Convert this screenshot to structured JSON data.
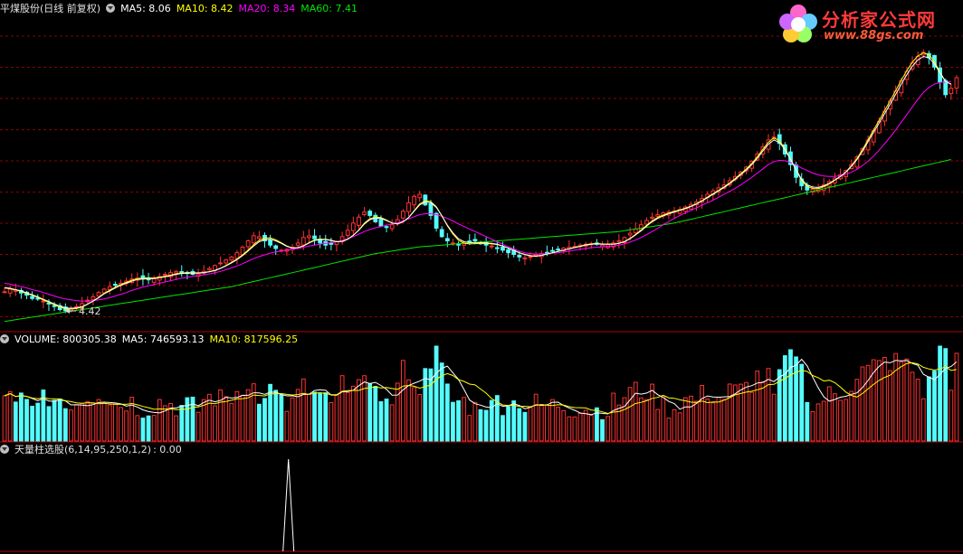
{
  "main_header": {
    "stock_name": "平煤股份(日线 前复权)",
    "ma5": "MA5: 8.06",
    "ma10": "MA10: 8.42",
    "ma20": "MA20: 8.34",
    "ma60": "MA60: 7.41"
  },
  "volume_header": {
    "volume": "VOLUME: 800305.38",
    "ma5": "MA5: 746593.13",
    "ma10": "MA10: 817596.25"
  },
  "indicator_header": {
    "label": "天量柱选股(6,14,95,250,1,2)",
    "value": ": 0.00"
  },
  "logo": {
    "title": "分析家公式网",
    "url": "www.88gs.com"
  },
  "low_marker": "4.42",
  "colors": {
    "up": "#ff3232",
    "down": "#54fcfc",
    "ma5": "#ffffff",
    "ma10": "#ffff00",
    "ma20": "#ff00ff",
    "ma60": "#00e600",
    "grid": "#8b0000",
    "divider": "#b00000"
  },
  "chart_data": {
    "type": "candlestick",
    "price_range": [
      4.0,
      11.4
    ],
    "indicator_signals_at_bar": [
      51,
      220
    ],
    "closes": [
      4.9,
      4.96,
      4.94,
      4.87,
      4.82,
      4.74,
      4.73,
      4.68,
      4.61,
      4.55,
      4.48,
      4.45,
      4.5,
      4.55,
      4.62,
      4.7,
      4.78,
      4.88,
      4.96,
      5.02,
      5.06,
      5.1,
      5.15,
      5.2,
      5.22,
      5.2,
      5.18,
      5.21,
      5.26,
      5.31,
      5.35,
      5.38,
      5.36,
      5.33,
      5.31,
      5.32,
      5.38,
      5.45,
      5.52,
      5.58,
      5.65,
      5.72,
      5.82,
      5.95,
      6.1,
      6.22,
      6.2,
      6.1,
      6.0,
      5.92,
      5.88,
      5.9,
      5.95,
      6.05,
      6.18,
      6.22,
      6.15,
      6.05,
      6.0,
      6.02,
      6.08,
      6.2,
      6.35,
      6.52,
      6.66,
      6.78,
      6.7,
      6.55,
      6.45,
      6.42,
      6.48,
      6.6,
      6.8,
      7.0,
      7.15,
      7.2,
      6.95,
      6.7,
      6.4,
      6.2,
      6.1,
      6.05,
      6.0,
      6.05,
      6.08,
      6.1,
      6.05,
      6.0,
      5.98,
      5.92,
      5.88,
      5.82,
      5.78,
      5.72,
      5.7,
      5.73,
      5.77,
      5.8,
      5.83,
      5.86,
      5.9,
      5.93,
      5.95,
      5.97,
      6.0,
      6.02,
      6.03,
      6.02,
      6.0,
      6.01,
      6.05,
      6.1,
      6.18,
      6.28,
      6.38,
      6.48,
      6.58,
      6.66,
      6.72,
      6.76,
      6.78,
      6.8,
      6.84,
      6.9,
      6.96,
      7.02,
      7.1,
      7.2,
      7.28,
      7.35,
      7.42,
      7.52,
      7.62,
      7.72,
      7.84,
      7.98,
      8.15,
      8.32,
      8.48,
      8.55,
      8.4,
      8.15,
      7.9,
      7.6,
      7.4,
      7.3,
      7.32,
      7.35,
      7.42,
      7.5,
      7.58,
      7.66,
      7.76,
      7.9,
      8.08,
      8.28,
      8.48,
      8.7,
      8.92,
      9.16,
      9.4,
      9.64,
      9.88,
      10.1,
      10.3,
      10.45,
      10.55,
      10.42,
      10.2,
      9.85,
      9.55,
      9.7,
      9.95
    ],
    "ma5": [
      5.0,
      4.98,
      4.95,
      4.92,
      4.87,
      4.83,
      4.78,
      4.72,
      4.67,
      4.61,
      4.56,
      4.52,
      4.51,
      4.52,
      4.55,
      4.61,
      4.68,
      4.76,
      4.85,
      4.92,
      4.99,
      5.05,
      5.1,
      5.15,
      5.19,
      5.2,
      5.21,
      5.21,
      5.23,
      5.25,
      5.28,
      5.31,
      5.33,
      5.34,
      5.34,
      5.34,
      5.35,
      5.37,
      5.4,
      5.45,
      5.51,
      5.58,
      5.66,
      5.75,
      5.86,
      5.98,
      6.08,
      6.13,
      6.14,
      6.1,
      6.04,
      5.97,
      5.93,
      5.94,
      5.98,
      6.05,
      6.11,
      6.13,
      6.13,
      6.11,
      6.08,
      6.09,
      6.14,
      6.23,
      6.35,
      6.5,
      6.6,
      6.64,
      6.63,
      6.58,
      6.52,
      6.5,
      6.55,
      6.65,
      6.8,
      6.95,
      7.02,
      7.0,
      6.89,
      6.69,
      6.47,
      6.29,
      6.15,
      6.08,
      6.06,
      6.06,
      6.06,
      6.05,
      6.04,
      6.02,
      5.98,
      5.93,
      5.88,
      5.82,
      5.78,
      5.75,
      5.74,
      5.76,
      5.79,
      5.82,
      5.85,
      5.88,
      5.91,
      5.94,
      5.97,
      6.0,
      6.02,
      6.03,
      6.02,
      6.02,
      6.02,
      6.04,
      6.08,
      6.15,
      6.24,
      6.34,
      6.45,
      6.55,
      6.63,
      6.69,
      6.74,
      6.78,
      6.82,
      6.86,
      6.91,
      6.97,
      7.04,
      7.12,
      7.2,
      7.28,
      7.36,
      7.45,
      7.55,
      7.66,
      7.77,
      7.9,
      8.05,
      8.22,
      8.38,
      8.48,
      8.42,
      8.25,
      8.02,
      7.78,
      7.55,
      7.42,
      7.37,
      7.36,
      7.4,
      7.46,
      7.54,
      7.62,
      7.72,
      7.86,
      8.02,
      8.22,
      8.44,
      8.66,
      8.88,
      9.1,
      9.33,
      9.56,
      9.8,
      10.02,
      10.22,
      10.37,
      10.45,
      10.42,
      10.28,
      10.06,
      9.86,
      9.8
    ],
    "ma20": [
      5.1,
      5.08,
      5.05,
      5.02,
      4.99,
      4.95,
      4.92,
      4.88,
      4.84,
      4.8,
      4.76,
      4.73,
      4.71,
      4.69,
      4.68,
      4.68,
      4.69,
      4.71,
      4.73,
      4.76,
      4.8,
      4.84,
      4.88,
      4.93,
      4.97,
      5.01,
      5.04,
      5.07,
      5.1,
      5.13,
      5.16,
      5.19,
      5.22,
      5.24,
      5.26,
      5.28,
      5.3,
      5.32,
      5.35,
      5.38,
      5.42,
      5.46,
      5.51,
      5.56,
      5.62,
      5.68,
      5.73,
      5.77,
      5.81,
      5.84,
      5.86,
      5.88,
      5.9,
      5.92,
      5.95,
      5.98,
      6.0,
      6.02,
      6.04,
      6.06,
      6.08,
      6.11,
      6.15,
      6.2,
      6.26,
      6.32,
      6.37,
      6.41,
      6.44,
      6.47,
      6.5,
      6.53,
      6.57,
      6.62,
      6.67,
      6.72,
      6.74,
      6.74,
      6.72,
      6.68,
      6.63,
      6.57,
      6.5,
      6.44,
      6.38,
      6.32,
      6.26,
      6.2,
      6.14,
      6.08,
      6.02,
      5.96,
      5.91,
      5.86,
      5.82,
      5.8,
      5.79,
      5.79,
      5.8,
      5.81,
      5.82,
      5.84,
      5.86,
      5.88,
      5.9,
      5.92,
      5.94,
      5.95,
      5.96,
      5.97,
      5.98,
      6.0,
      6.03,
      6.07,
      6.12,
      6.18,
      6.25,
      6.32,
      6.4,
      6.48,
      6.56,
      6.63,
      6.7,
      6.76,
      6.82,
      6.88,
      6.94,
      7.0,
      7.06,
      7.13,
      7.2,
      7.27,
      7.34,
      7.42,
      7.51,
      7.6,
      7.7,
      7.8,
      7.9,
      7.97,
      8.0,
      7.99,
      7.95,
      7.89,
      7.82,
      7.76,
      7.7,
      7.66,
      7.63,
      7.62,
      7.62,
      7.64,
      7.67,
      7.72,
      7.79,
      7.88,
      7.98,
      8.1,
      8.24,
      8.39,
      8.55,
      8.72,
      8.9,
      9.08,
      9.26,
      9.44,
      9.6,
      9.72,
      9.8,
      9.84,
      9.85,
      9.86
    ],
    "ma60": [
      4.2,
      4.22,
      4.24,
      4.26,
      4.28,
      4.3,
      4.32,
      4.34,
      4.36,
      4.38,
      4.4,
      4.42,
      4.44,
      4.46,
      4.48,
      4.5,
      4.52,
      4.54,
      4.56,
      4.58,
      4.6,
      4.62,
      4.64,
      4.66,
      4.68,
      4.7,
      4.72,
      4.74,
      4.76,
      4.78,
      4.8,
      4.82,
      4.84,
      4.86,
      4.88,
      4.9,
      4.92,
      4.94,
      4.96,
      4.98,
      5.0,
      5.02,
      5.05,
      5.08,
      5.11,
      5.14,
      5.17,
      5.2,
      5.23,
      5.26,
      5.29,
      5.32,
      5.35,
      5.38,
      5.41,
      5.44,
      5.47,
      5.5,
      5.53,
      5.56,
      5.59,
      5.62,
      5.65,
      5.68,
      5.71,
      5.74,
      5.77,
      5.8,
      5.82,
      5.84,
      5.86,
      5.88,
      5.9,
      5.92,
      5.94,
      5.96,
      5.97,
      5.98,
      5.99,
      6.0,
      6.01,
      6.02,
      6.03,
      6.04,
      6.05,
      6.06,
      6.07,
      6.08,
      6.09,
      6.1,
      6.11,
      6.12,
      6.13,
      6.14,
      6.15,
      6.16,
      6.17,
      6.18,
      6.19,
      6.2,
      6.21,
      6.22,
      6.23,
      6.24,
      6.25,
      6.26,
      6.27,
      6.28,
      6.29,
      6.3,
      6.31,
      6.32,
      6.34,
      6.36,
      6.38,
      6.4,
      6.42,
      6.44,
      6.46,
      6.48,
      6.5,
      6.52,
      6.55,
      6.58,
      6.61,
      6.64,
      6.67,
      6.7,
      6.73,
      6.76,
      6.79,
      6.82,
      6.85,
      6.88,
      6.91,
      6.94,
      6.97,
      7.0,
      7.03,
      7.06,
      7.09,
      7.12,
      7.15,
      7.18,
      7.21,
      7.24,
      7.27,
      7.3,
      7.33,
      7.36,
      7.39,
      7.42,
      7.45,
      7.48,
      7.51,
      7.54,
      7.57,
      7.6,
      7.63,
      7.66,
      7.69,
      7.72,
      7.75,
      7.78,
      7.81,
      7.84,
      7.87,
      7.9,
      7.93,
      7.96,
      7.99,
      8.02
    ]
  }
}
